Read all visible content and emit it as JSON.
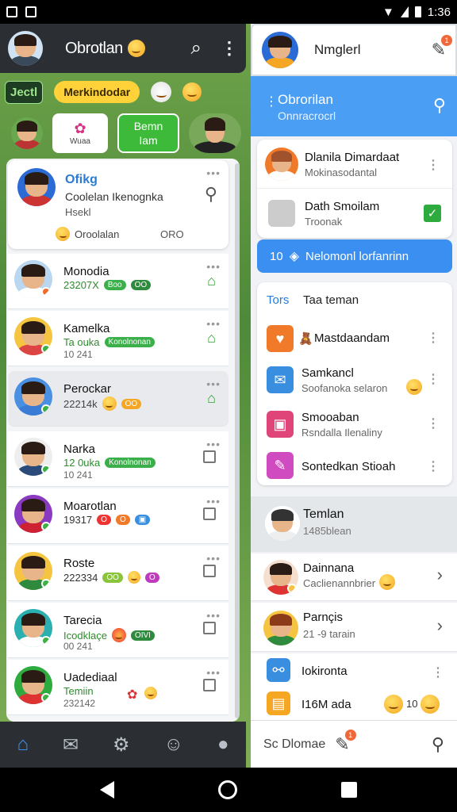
{
  "status_bar": {
    "time": "1:36"
  },
  "left": {
    "header": {
      "title": "Obrotlan",
      "search_icon": "search-icon",
      "menu_icon": "kebab-menu-icon"
    },
    "chips": {
      "dark": "Jectl",
      "yellow": "Merkindodar"
    },
    "stories": [
      {
        "label": "Wuaa"
      },
      {
        "line1": "Bemn",
        "line2": "Iam"
      }
    ],
    "featured": {
      "name": "Ofikg",
      "subtitle": "Coolelan Ikenognka",
      "line3": "Hsekl",
      "status": "Oroolalan",
      "count": "ORO"
    },
    "rows": [
      {
        "name": "Monodia",
        "sub": "23207X",
        "pills": [
          "Boo",
          "OO"
        ],
        "time": "",
        "icon": "house-icon"
      },
      {
        "name": "Kamelka",
        "sub": "Ta ouka",
        "pills": [
          "Konolnonan"
        ],
        "time": "10 241",
        "icon": "house-icon"
      },
      {
        "name": "Perockar",
        "sub": "22214k",
        "pills": [
          "OO"
        ],
        "time": "",
        "icon": "house-icon"
      },
      {
        "name": "Narka",
        "sub": "12 0uka",
        "pills": [
          "Konolnonan"
        ],
        "time": "10 241",
        "icon": "checkbox-icon"
      },
      {
        "name": "Moarotlan",
        "sub": "19317",
        "pills": [
          "O",
          "O"
        ],
        "time": "",
        "icon": "checkbox-icon"
      },
      {
        "name": "Roste",
        "sub": "222334",
        "pills": [
          "OO",
          "O"
        ],
        "time": "",
        "icon": "checkbox-icon"
      },
      {
        "name": "Tarecia",
        "sub": "Icodklaçe",
        "pills": [
          "OIVI"
        ],
        "time": "00 241",
        "icon": "checkbox-icon"
      },
      {
        "name": "Uadediaal",
        "sub": "Temiin",
        "pills": [],
        "time": "232142",
        "icon": "checkbox-icon"
      }
    ],
    "nav": [
      "home-icon",
      "mail-icon",
      "settings-icon",
      "chat-icon",
      "profile-icon"
    ]
  },
  "right": {
    "header": {
      "title": "Nmglerl",
      "badge": "1"
    },
    "blue": {
      "title": "Obrorilan",
      "subtitle": "Onnracrocrl"
    },
    "card1": {
      "rows": [
        {
          "name": "Dlanila Dimardaat",
          "sub": "Mokinasodantal"
        },
        {
          "name": "Dath Smoilam",
          "sub": "Troonak"
        }
      ]
    },
    "blue_button": {
      "num": "10",
      "label": "Nelomonl lorfanrinn"
    },
    "card2": {
      "header": "Tors",
      "header2": "Taa teman",
      "rows": [
        {
          "name": "Mastdaandam",
          "sub": ""
        },
        {
          "name": "Samkancl",
          "sub": "Soofanoka selaron"
        },
        {
          "name": "Smooaban",
          "sub": "Rsndalla Ilenaliny"
        },
        {
          "name": "Sontedkan Stioah",
          "sub": ""
        }
      ]
    },
    "group": {
      "name": "Temlan",
      "sub": "1485blean"
    },
    "list": [
      {
        "name": "Dainnana",
        "sub": "Caclienannbrier"
      },
      {
        "name": "Parnçis",
        "sub": "21 -9 tarain"
      },
      {
        "name": "Iokironta",
        "sub": ""
      },
      {
        "name": "I16M ada",
        "sub": "",
        "num": "10"
      }
    ],
    "bottom": {
      "text": "Sc Dlomae",
      "badge": "1"
    }
  },
  "colors": {
    "accent_blue": "#3b8ff0",
    "green": "#2eab3e",
    "dark": "#2b2f33"
  }
}
